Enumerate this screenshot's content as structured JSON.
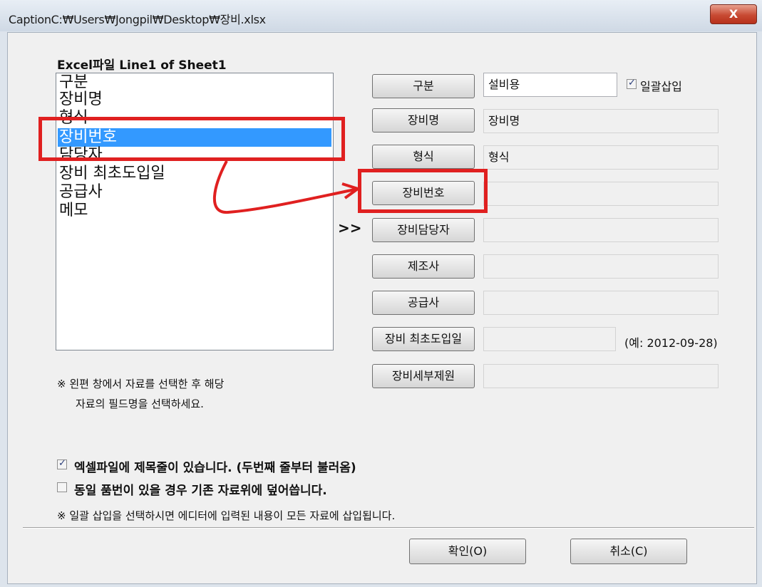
{
  "window": {
    "title": "CaptionC:₩Users₩Jongpil₩Desktop₩장비.xlsx",
    "close_label": "X"
  },
  "left_panel": {
    "heading": "Excel파일 Line1 of Sheet1",
    "items": [
      "구분",
      "장비명",
      "형식",
      "장비번호",
      "담당자",
      "장비 최초도입일",
      "공급사",
      "메모"
    ],
    "selected_index": 3,
    "note_line1": "※ 왼편 창에서 자료를 선택한 후 해당",
    "note_line2": "자료의 필드명을 선택하세요."
  },
  "arrow_marker": ">>",
  "fields": [
    {
      "button": "구분",
      "value": "설비용"
    },
    {
      "button": "장비명",
      "value": "장비명"
    },
    {
      "button": "형식",
      "value": "형식"
    },
    {
      "button": "장비번호",
      "value": ""
    },
    {
      "button": "장비담당자",
      "value": ""
    },
    {
      "button": "제조사",
      "value": ""
    },
    {
      "button": "공급사",
      "value": ""
    },
    {
      "button": "장비 최초도입일",
      "value": ""
    },
    {
      "button": "장비세부제원",
      "value": ""
    }
  ],
  "bulk_insert": {
    "label": "일괄삽입",
    "checked": true
  },
  "date_hint": "(예: 2012-09-28)",
  "options": {
    "header_row": {
      "label": "엑셀파일에 제목줄이 있습니다. (두번째 줄부터 불러옴)",
      "checked": true
    },
    "overwrite": {
      "label": "동일 품번이 있을 경우 기존 자료위에 덮어씁니다.",
      "checked": false
    }
  },
  "bottom_note": "※ 일괄 삽입을 선택하시면 에디터에 입력된 내용이 모든 자료에 삽입됩니다.",
  "buttons": {
    "ok": "확인(O)",
    "cancel": "취소(C)"
  },
  "annotation_color": "#e02020"
}
